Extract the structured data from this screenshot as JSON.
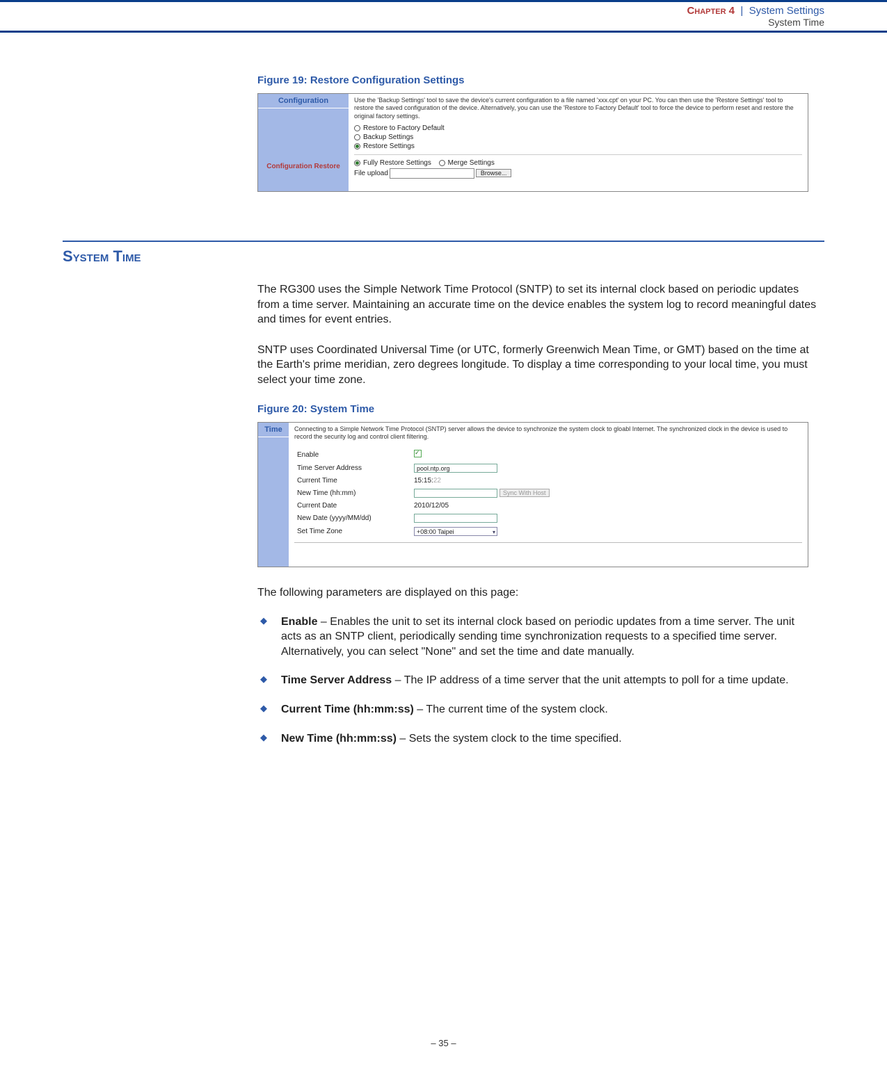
{
  "header": {
    "chapter_label": "Chapter 4",
    "chapter_title": "System Settings",
    "page_subtitle": "System Time"
  },
  "figure19": {
    "caption": "Figure 19:  Restore Configuration Settings",
    "sidebar_header": "Configuration",
    "sidebar_selected": "Configuration Restore",
    "description": "Use the 'Backup Settings' tool to save the device's current configuration to a file named 'xxx.cpt' on your PC. You can then use the 'Restore Settings' tool to restore the saved configuration of the device. Alternatively, you can use the 'Restore to Factory Default' tool to force the device to perform reset and restore the original factory settings.",
    "options": {
      "restore_default": "Restore to Factory Default",
      "backup": "Backup Settings",
      "restore": "Restore Settings"
    },
    "sub_options": {
      "fully": "Fully Restore Settings",
      "merge": "Merge Settings"
    },
    "file_label": "File upload",
    "browse": "Browse..."
  },
  "section": {
    "title": "System Time",
    "para1": "The RG300 uses the Simple Network Time Protocol (SNTP) to set its internal clock based on periodic updates from a time server. Maintaining an accurate time on the device enables the system log to record meaningful dates and times for event entries.",
    "para2": "SNTP uses Coordinated Universal Time (or UTC, formerly Greenwich Mean Time, or GMT) based on the time at the Earth's prime meridian, zero degrees longitude. To display a time corresponding to your local time, you must select your time zone."
  },
  "figure20": {
    "caption": "Figure 20:  System Time",
    "sidebar_header": "Time",
    "description": "Connecting to a Simple Network Time Protocol (SNTP) server allows the device to synchronize the system clock to gloabl Internet. The synchronized clock in the device is used to record the security log and control client filtering.",
    "rows": {
      "enable": "Enable",
      "server": "Time Server Address",
      "server_val": "pool.ntp.org",
      "curtime": "Current Time",
      "curtime_val": "15:15:",
      "curtime_sec": "22",
      "newtime": "New Time (hh:mm)",
      "sync": "Sync With Host",
      "curdate": "Current Date",
      "curdate_val": "2010/12/05",
      "newdate": "New Date (yyyy/MM/dd)",
      "tz": "Set Time Zone",
      "tz_val": "+08:00 Taipei"
    }
  },
  "params_intro": "The following parameters are displayed on this page:",
  "params": {
    "enable_t": "Enable",
    "enable_d": " – Enables the unit to set its internal clock based on periodic updates from a time server. The unit acts as an SNTP client, periodically sending time synchronization requests to a specified time server. Alternatively, you can select \"None\" and set the time and date manually.",
    "server_t": "Time Server Address",
    "server_d": " – The IP address of a time server that the unit attempts to poll for a time update.",
    "curtime_t": "Current Time (hh:mm:ss)",
    "curtime_d": " – The current time of the system clock.",
    "newtime_t": "New Time (hh:mm:ss)",
    "newtime_d": " – Sets the system clock to the time specified."
  },
  "footer": {
    "page": "–  35  –"
  }
}
